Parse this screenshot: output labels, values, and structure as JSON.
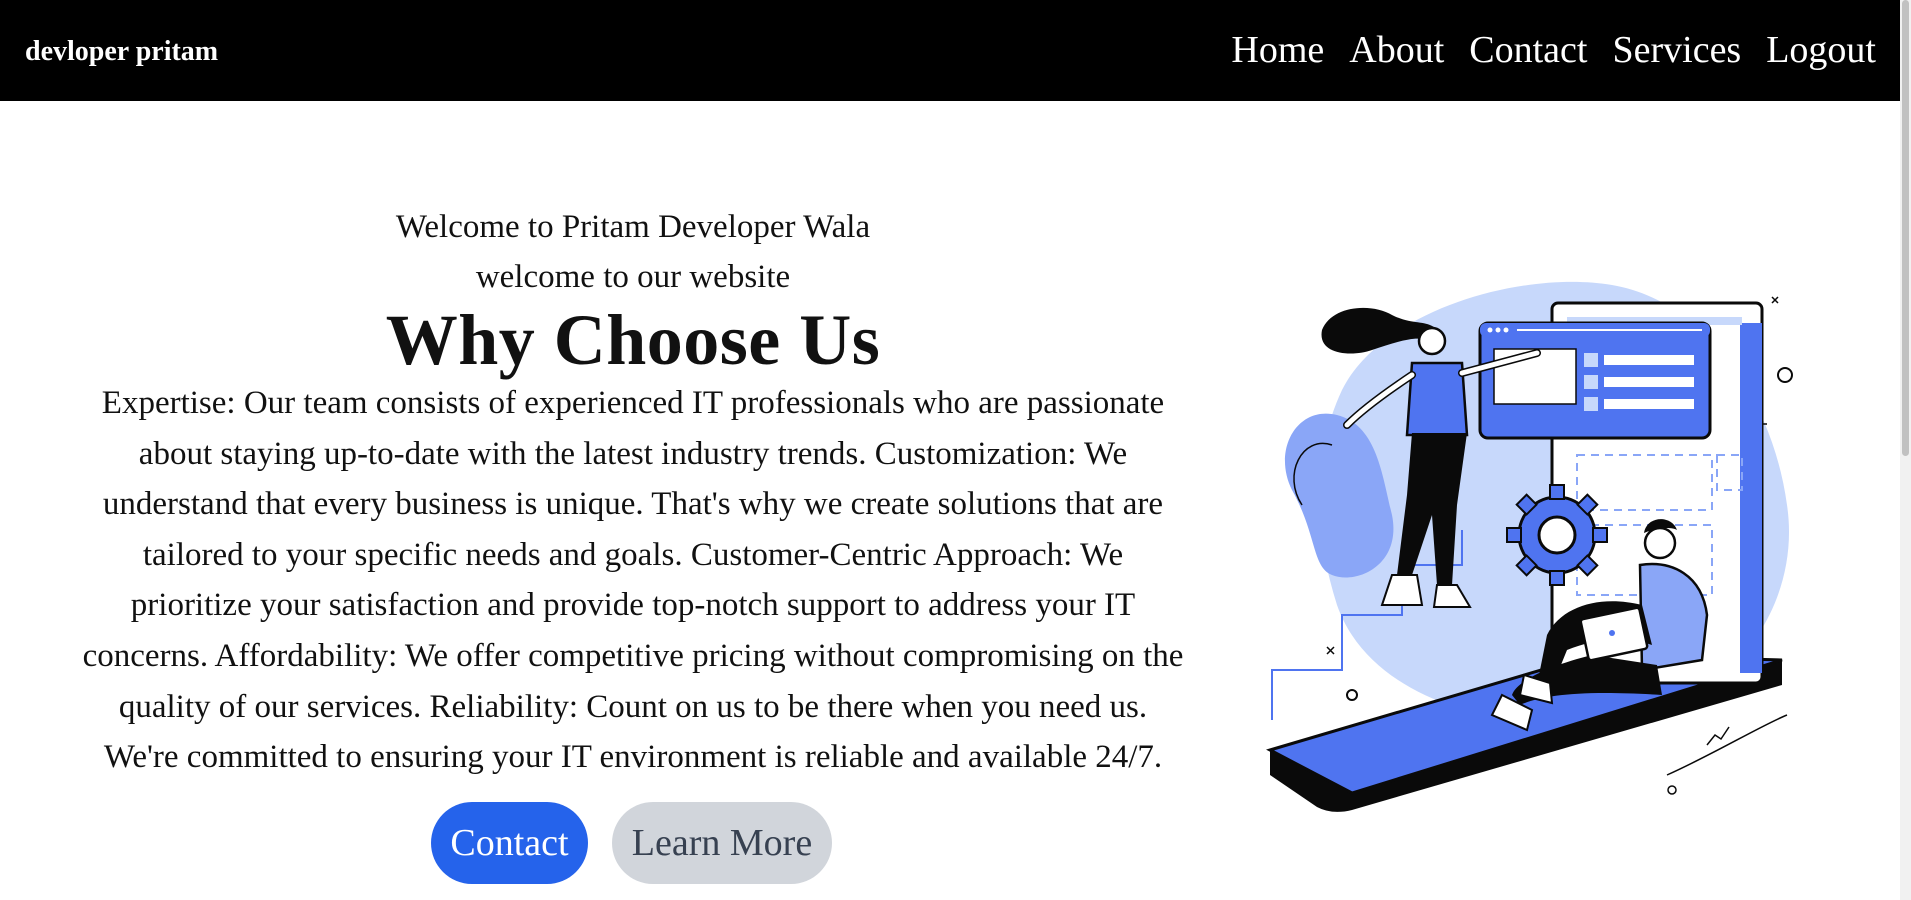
{
  "navbar": {
    "brand": "devloper pritam",
    "links": [
      "Home",
      "About",
      "Contact",
      "Services",
      "Logout"
    ]
  },
  "hero": {
    "greeting": "Welcome to Pritam Developer Wala",
    "sub_greeting": "welcome to our website",
    "heading": "Why Choose Us",
    "body": "Expertise: Our team consists of experienced IT professionals who are passionate about staying up-to-date with the latest industry trends. Customization: We understand that every business is unique. That's why we create solutions that are tailored to your specific needs and goals. Customer-Centric Approach: We prioritize your satisfaction and provide top-notch support to address your IT concerns. Affordability: We offer competitive pricing without compromising on the quality of our services. Reliability: Count on us to be there when you need us. We're committed to ensuring your IT environment is reliable and available 24/7.",
    "contact_button": "Contact",
    "learn_more_button": "Learn More"
  },
  "illustration": {
    "icon": "developers-illustration",
    "colors": {
      "primary": "#4f74f0",
      "light": "#c7d8fb",
      "dark": "#0a0a0a"
    }
  },
  "colors": {
    "navbar_bg": "#000000",
    "contact_button_bg": "#2563eb",
    "learn_more_button_bg": "#d1d5db"
  }
}
